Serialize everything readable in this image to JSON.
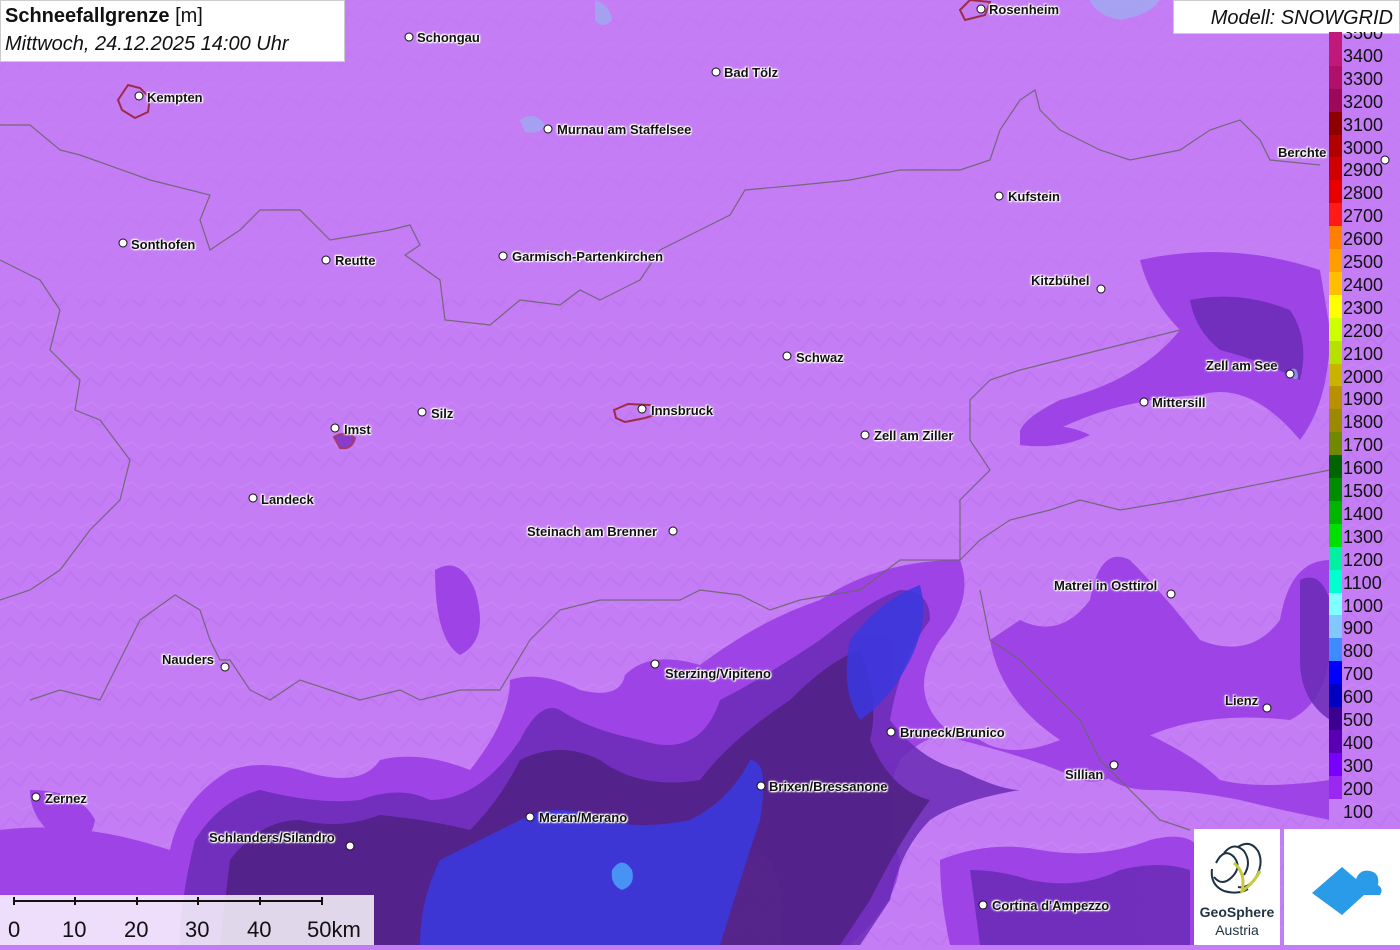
{
  "header": {
    "title_bold": "Schneefallgrenze",
    "title_unit": "[m]",
    "datetime": "Mittwoch, 24.12.2025 14:00 Uhr",
    "model": "Modell: SNOWGRID"
  },
  "legend": {
    "items": [
      {
        "label": "3500",
        "color": "#c2187a"
      },
      {
        "label": "3400",
        "color": "#c2187a"
      },
      {
        "label": "3300",
        "color": "#b01068"
      },
      {
        "label": "3200",
        "color": "#9e0858"
      },
      {
        "label": "3100",
        "color": "#8e0000"
      },
      {
        "label": "3000",
        "color": "#b00000"
      },
      {
        "label": "2900",
        "color": "#d00000"
      },
      {
        "label": "2800",
        "color": "#e60000"
      },
      {
        "label": "2700",
        "color": "#ff1a1a"
      },
      {
        "label": "2600",
        "color": "#ff8000"
      },
      {
        "label": "2500",
        "color": "#ff9e00"
      },
      {
        "label": "2400",
        "color": "#ffbf00"
      },
      {
        "label": "2300",
        "color": "#ffff00"
      },
      {
        "label": "2200",
        "color": "#ccff00"
      },
      {
        "label": "2100",
        "color": "#b5e000"
      },
      {
        "label": "2000",
        "color": "#c8b400"
      },
      {
        "label": "1900",
        "color": "#b89000"
      },
      {
        "label": "1800",
        "color": "#9a8a00"
      },
      {
        "label": "1700",
        "color": "#6f8a00"
      },
      {
        "label": "1600",
        "color": "#006400"
      },
      {
        "label": "1500",
        "color": "#008c00"
      },
      {
        "label": "1400",
        "color": "#00b400"
      },
      {
        "label": "1300",
        "color": "#00e000"
      },
      {
        "label": "1200",
        "color": "#00f0a0"
      },
      {
        "label": "1100",
        "color": "#00ffd0"
      },
      {
        "label": "1000",
        "color": "#80ffff"
      },
      {
        "label": "900",
        "color": "#80c8ff"
      },
      {
        "label": "800",
        "color": "#3c8cff"
      },
      {
        "label": "700",
        "color": "#0000ff"
      },
      {
        "label": "600",
        "color": "#0000c0"
      },
      {
        "label": "500",
        "color": "#3c0090"
      },
      {
        "label": "400",
        "color": "#5a00b4"
      },
      {
        "label": "300",
        "color": "#7800ff"
      },
      {
        "label": "200",
        "color": "#9a28f0"
      },
      {
        "label": "100",
        "color": "#c47df4"
      }
    ]
  },
  "cities": [
    {
      "name": "Rosenheim"
    },
    {
      "name": "Schongau"
    },
    {
      "name": "Bad Tölz"
    },
    {
      "name": "Kempten"
    },
    {
      "name": "Murnau am Staffelsee"
    },
    {
      "name": "Berchte"
    },
    {
      "name": "Kufstein"
    },
    {
      "name": "Sonthofen"
    },
    {
      "name": "Reutte"
    },
    {
      "name": "Garmisch-Partenkirchen"
    },
    {
      "name": "Kitzbühel"
    },
    {
      "name": "Schwaz"
    },
    {
      "name": "Zell am See"
    },
    {
      "name": "Mittersill"
    },
    {
      "name": "Innsbruck"
    },
    {
      "name": "Imst"
    },
    {
      "name": "Silz"
    },
    {
      "name": "Zell am Ziller"
    },
    {
      "name": "Landeck"
    },
    {
      "name": "Steinach am Brenner"
    },
    {
      "name": "Matrei in Osttirol"
    },
    {
      "name": "Nauders"
    },
    {
      "name": "Sterzing/Vipiteno"
    },
    {
      "name": "Lienz"
    },
    {
      "name": "Bruneck/Brunico"
    },
    {
      "name": "Sillian"
    },
    {
      "name": "Brixen/Bressanone"
    },
    {
      "name": "Zernez"
    },
    {
      "name": "Meran/Merano"
    },
    {
      "name": "Schlanders/Silandro"
    },
    {
      "name": "Cortina d'Ampezzo"
    }
  ],
  "scalebar": {
    "labels": [
      "0",
      "10",
      "20",
      "30",
      "40",
      "50km"
    ]
  },
  "logos": {
    "geosphere_name": "GeoSphere",
    "geosphere_sub": "Austria"
  }
}
